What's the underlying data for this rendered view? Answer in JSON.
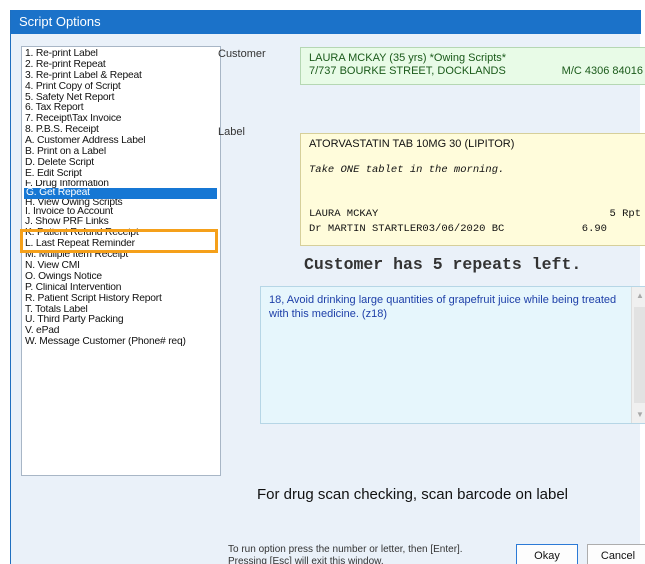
{
  "window": {
    "title": "Script Options"
  },
  "options": [
    "1. Re-print Label",
    "2. Re-print Repeat",
    "3. Re-print Label & Repeat",
    "4. Print Copy of Script",
    "5. Safety Net Report",
    "6. Tax Report",
    "7. Receipt\\Tax Invoice",
    "8. P.B.S. Receipt",
    "A. Customer Address Label",
    "B. Print on a Label",
    "D. Delete Script",
    "E. Edit Script",
    "F. Drug Information",
    "G. Get Repeat",
    "H. View Owing Scripts",
    "I. Invoice to Account",
    "J. Show PRF Links",
    "K. Patient Refund Receipt",
    "L. Last Repeat Reminder",
    "M. Muliple Item Receipt",
    "N. View CMI",
    "O. Owings Notice",
    "P. Clinical Intervention",
    "R. Patient Script History Report",
    "T. Totals Label",
    "U. Third Party Packing",
    "V. ePad",
    "W. Message Customer (Phone# req)"
  ],
  "selected_option": "G. Get Repeat",
  "customer": {
    "label": "Customer",
    "line1": "LAURA MCKAY (35 yrs) *Owing Scripts*",
    "line2": "7/737 BOURKE STREET, DOCKLANDS",
    "medicare": "M/C 4306 84016"
  },
  "label_section": {
    "label": "Label",
    "drug": "ATORVASTATIN TAB 10MG 30 (LIPITOR)",
    "instructions": "Take ONE tablet in the morning.",
    "patient": "LAURA MCKAY",
    "repeats_tag": "5 Rpt",
    "doctor_date": "Dr MARTIN STARTLER03/06/2020 BC",
    "price": "6.90"
  },
  "repeats_message": "Customer has 5 repeats left.",
  "warning": {
    "text": "18,    Avoid drinking large quantities of grapefruit juice while being treated with this medicine. (z18)"
  },
  "scan_message": "For drug scan checking, scan barcode on label",
  "hint": {
    "line1": "To run option press the number or letter, then [Enter].",
    "line2": "Pressing [Esc] will exit this window."
  },
  "buttons": {
    "okay": "Okay",
    "cancel": "Cancel"
  },
  "colors": {
    "titlebar": "#1b72c9",
    "selection": "#1677d4",
    "highlight_frame": "#f5a01a",
    "customer_bg": "#e8fbe7",
    "label_bg": "#fffcdb",
    "warning_bg": "#e6f6fc"
  },
  "icons": {
    "scroll_up": "chevron-up-icon",
    "scroll_down": "chevron-down-icon"
  }
}
